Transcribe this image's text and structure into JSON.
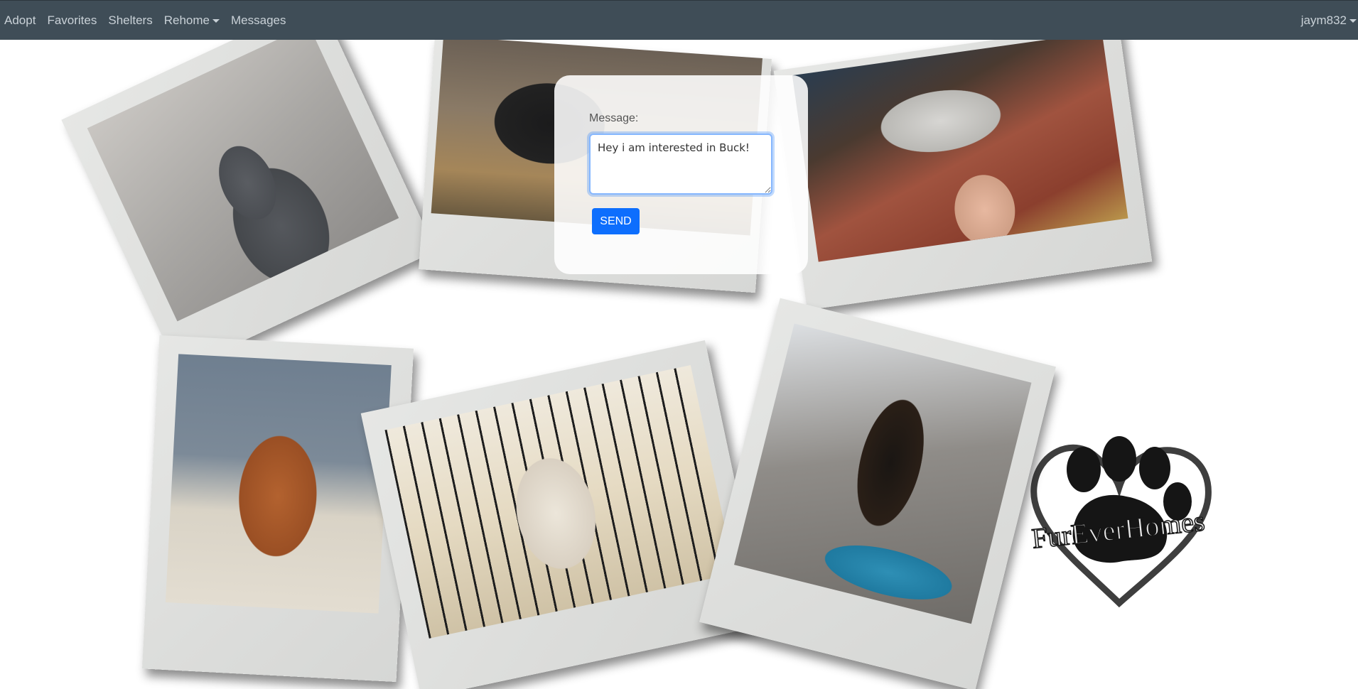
{
  "navbar": {
    "items": [
      {
        "label": "Adopt"
      },
      {
        "label": "Favorites"
      },
      {
        "label": "Shelters"
      },
      {
        "label": "Rehome"
      },
      {
        "label": "Messages"
      }
    ],
    "user": "jaym832"
  },
  "message_form": {
    "label": "Message:",
    "value": "Hey i am interested in Buck!",
    "send_label": "SEND"
  },
  "logo": {
    "text": "FurEverHomes"
  }
}
